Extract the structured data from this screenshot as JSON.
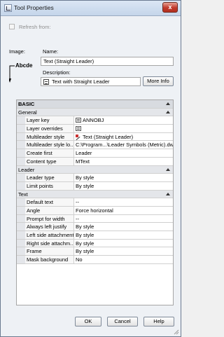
{
  "window": {
    "title": "Tool Properties",
    "close_glyph": "x"
  },
  "refresh": {
    "label": "Refresh from:",
    "checked": false
  },
  "image": {
    "label": "Image:",
    "preview_text": "Abcde"
  },
  "name": {
    "label": "Name:",
    "value": "Text (Straight Leader)"
  },
  "description": {
    "label": "Description:",
    "value": "Text with Straight Leader",
    "icon": "text-document-icon"
  },
  "buttons": {
    "more_info": "More Info",
    "ok": "OK",
    "cancel": "Cancel",
    "help": "Help"
  },
  "grid": {
    "basic_header": "BASIC",
    "general": {
      "label": "General",
      "rows": [
        {
          "name": "Layer key",
          "value": "ANNOBJ",
          "icon": "layer-icon"
        },
        {
          "name": "Layer overrides",
          "value": "",
          "icon": "layer-icon"
        },
        {
          "name": "Multileader style",
          "value": "Text (Straight Leader)",
          "icon": "leader-icon"
        },
        {
          "name": "Multileader style lo...",
          "value": "C:\\Program...\\Leader Symbols (Metric).dwg",
          "icon": ""
        },
        {
          "name": "Create first",
          "value": "Leader",
          "icon": ""
        },
        {
          "name": "Content type",
          "value": "MText",
          "icon": ""
        }
      ]
    },
    "leader": {
      "label": "Leader",
      "rows": [
        {
          "name": "Leader type",
          "value": "By style"
        },
        {
          "name": "Limit points",
          "value": "By style"
        }
      ]
    },
    "text": {
      "label": "Text",
      "rows": [
        {
          "name": "Default text",
          "value": "--"
        },
        {
          "name": "Angle",
          "value": "Force horizontal"
        },
        {
          "name": "Prompt for width",
          "value": "--"
        },
        {
          "name": "Always left justify",
          "value": "By style"
        },
        {
          "name": "Left side attachment",
          "value": "By style"
        },
        {
          "name": "Right side attachm...",
          "value": "By style"
        },
        {
          "name": "Frame",
          "value": "By style"
        },
        {
          "name": "Mask background",
          "value": "No"
        }
      ]
    }
  },
  "colors": {
    "titlebar": "#c4d5ea",
    "close": "#c0392b",
    "section_bg": "#d8dbe0"
  }
}
